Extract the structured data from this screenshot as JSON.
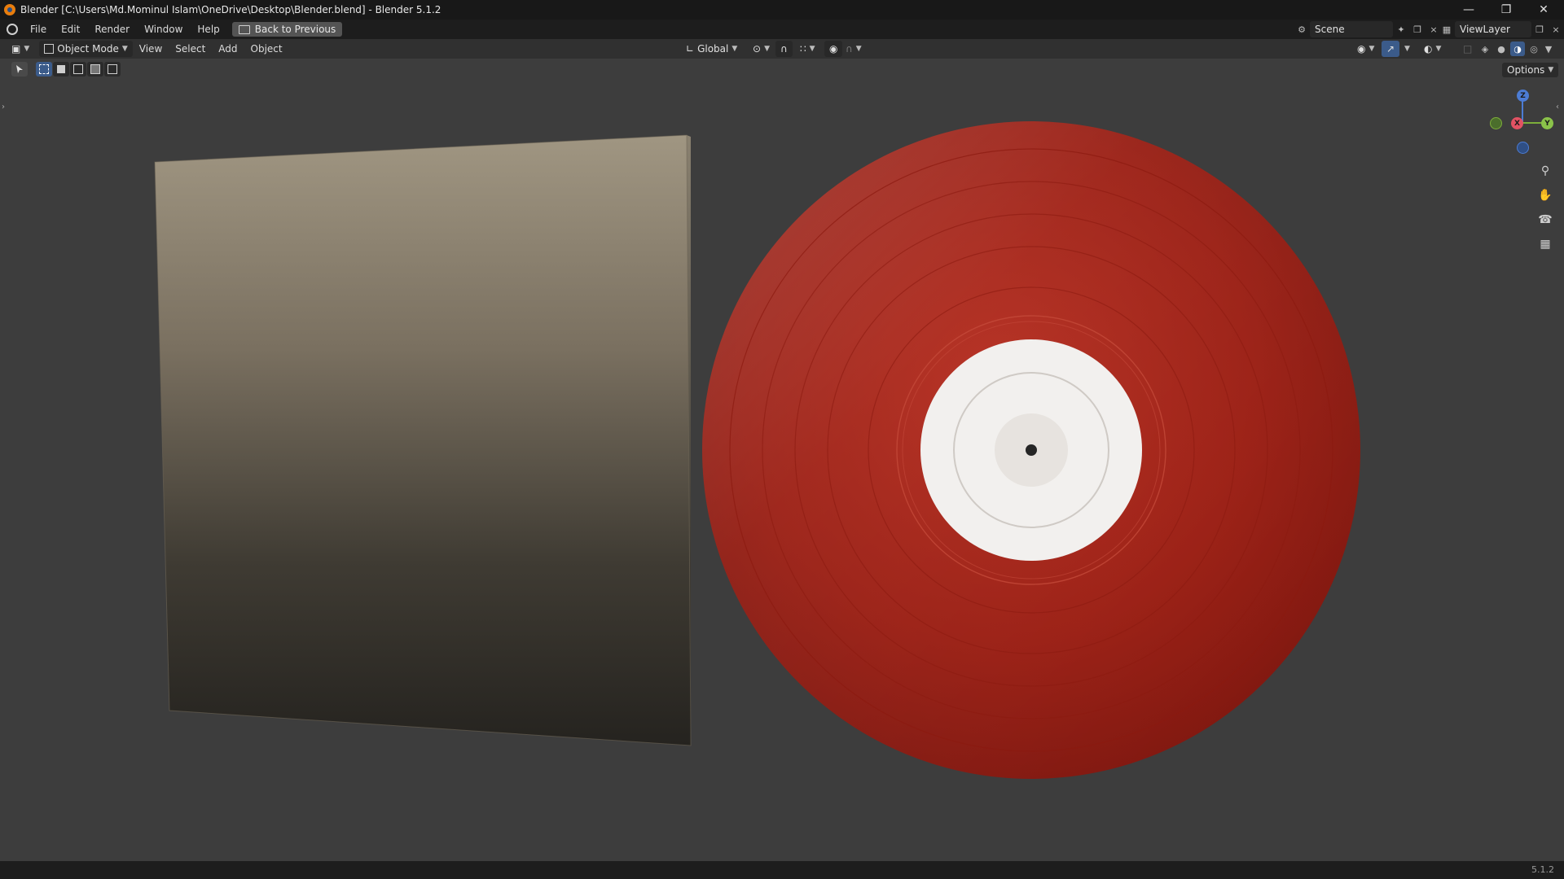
{
  "window": {
    "title": "Blender [C:\\Users\\Md.Mominul Islam\\OneDrive\\Desktop\\Blender.blend] - Blender 5.1.2",
    "controls": [
      "minimize-icon",
      "restore-icon",
      "close-icon"
    ]
  },
  "menubar": {
    "items": [
      "File",
      "Edit",
      "Render",
      "Window",
      "Help"
    ],
    "back_label": "Back to Previous",
    "scene_label": "Scene",
    "viewlayer_label": "ViewLayer"
  },
  "header": {
    "mode_label": "Object Mode",
    "menu": [
      "View",
      "Select",
      "Add",
      "Object"
    ],
    "orientation_label": "Global"
  },
  "toolbar": {
    "options_label": "Options"
  },
  "gizmo": {
    "z_label": "Z",
    "y_label": "Y",
    "x_label": "X"
  },
  "viewport": {
    "objects": [
      "album-sleeve",
      "vinyl-record"
    ],
    "record_color": "#a01f14",
    "label_color": "#f2f0ee"
  },
  "statusbar": {
    "version": "5.1.2"
  }
}
